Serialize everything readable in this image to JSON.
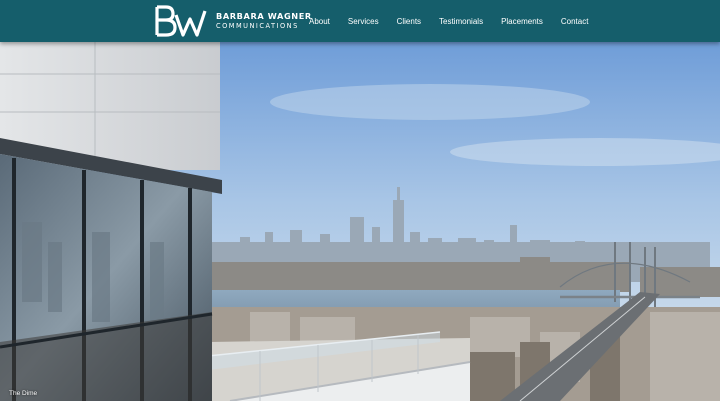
{
  "logo": {
    "mark": "BW",
    "name": "BARBARA WAGNER",
    "subtitle": "COMMUNICATIONS"
  },
  "nav": {
    "items": [
      {
        "label": "About"
      },
      {
        "label": "Services"
      },
      {
        "label": "Clients"
      },
      {
        "label": "Testimonials"
      },
      {
        "label": "Placements"
      },
      {
        "label": "Contact"
      }
    ]
  },
  "hero": {
    "caption": "The Dime"
  },
  "colors": {
    "header": "#155e6b",
    "nav_text": "#ffffff"
  }
}
